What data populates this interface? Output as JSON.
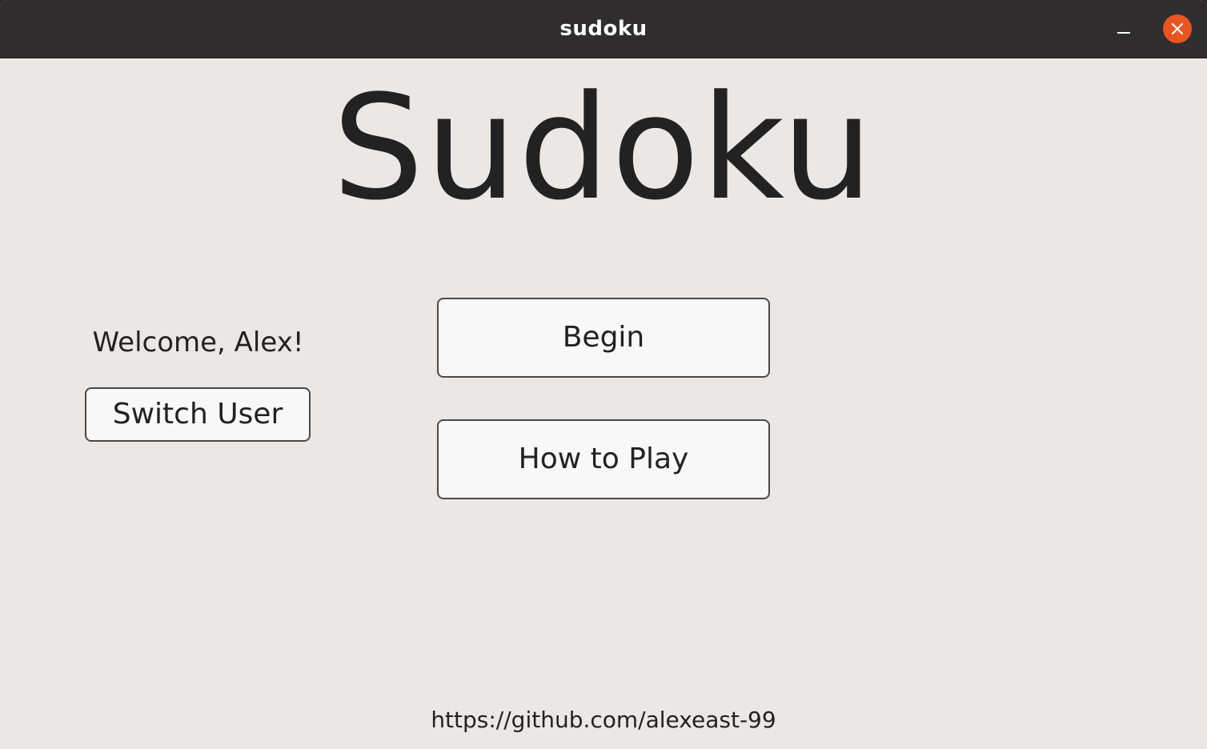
{
  "window": {
    "title": "sudoku"
  },
  "main": {
    "heading": "Sudoku",
    "welcome": "Welcome, Alex!",
    "switch_user_label": "Switch User",
    "begin_label": "Begin",
    "how_to_play_label": "How to Play",
    "footer_link": "https://github.com/alexeast-99"
  },
  "colors": {
    "titlebar": "#302d2f",
    "background": "#ebe7e4",
    "close_accent": "#e95420",
    "button_fill": "#f8f8f8",
    "button_border": "#4a4a4a",
    "text": "#222222"
  },
  "icons": {
    "minimize": "minimize-icon",
    "close": "close-icon"
  }
}
